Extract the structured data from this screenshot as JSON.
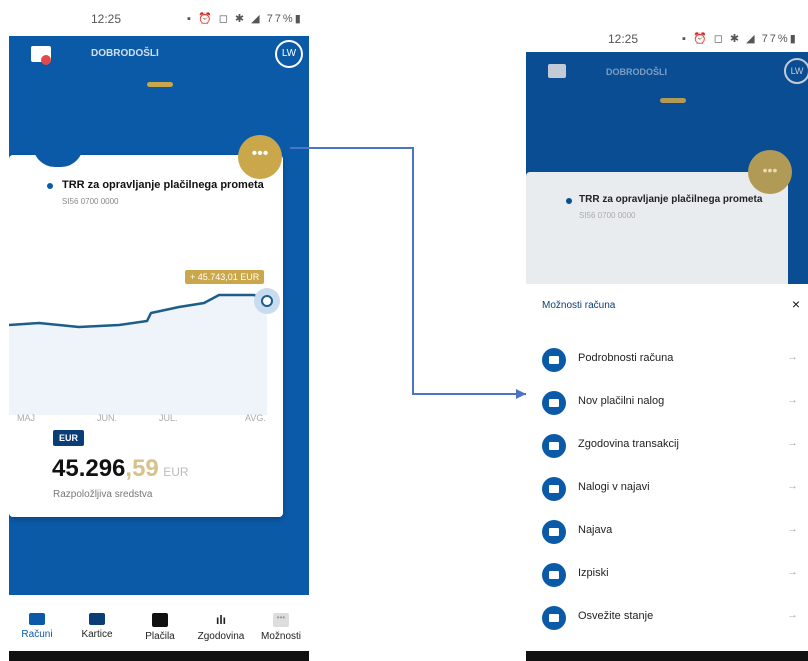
{
  "status": {
    "time": "12:25",
    "battery": "77%"
  },
  "header": {
    "title": "DOBRODOŠLI",
    "avatar_initials": "LW"
  },
  "account": {
    "name": "TRR za opravljanje plačilnega prometa",
    "iban": "SI56 0700 0000",
    "chart_tooltip": "+ 45.743,01 EUR",
    "months": [
      "MAJ",
      "JUN.",
      "JUL.",
      "AVG."
    ],
    "currency_badge": "EUR",
    "balance_int": "45.296",
    "balance_dec": ",59",
    "balance_currency": "EUR",
    "balance_label": "Razpoložljiva sredstva"
  },
  "tabs": [
    {
      "label": "Računi"
    },
    {
      "label": "Kartice"
    },
    {
      "label": "Plačila"
    },
    {
      "label": "Zgodovina"
    },
    {
      "label": "Možnosti"
    }
  ],
  "sheet": {
    "title": "Možnosti računa",
    "close": "×",
    "items": [
      {
        "label": "Podrobnosti računa"
      },
      {
        "label": "Nov plačilni nalog"
      },
      {
        "label": "Zgodovina transakcij"
      },
      {
        "label": "Nalogi v najavi"
      },
      {
        "label": "Najava"
      },
      {
        "label": "Izpiski"
      },
      {
        "label": "Osvežite stanje"
      }
    ]
  },
  "colors": {
    "brand_blue": "#0b5aa8",
    "gold": "#c9a74a",
    "line": "#1c5d8a"
  }
}
